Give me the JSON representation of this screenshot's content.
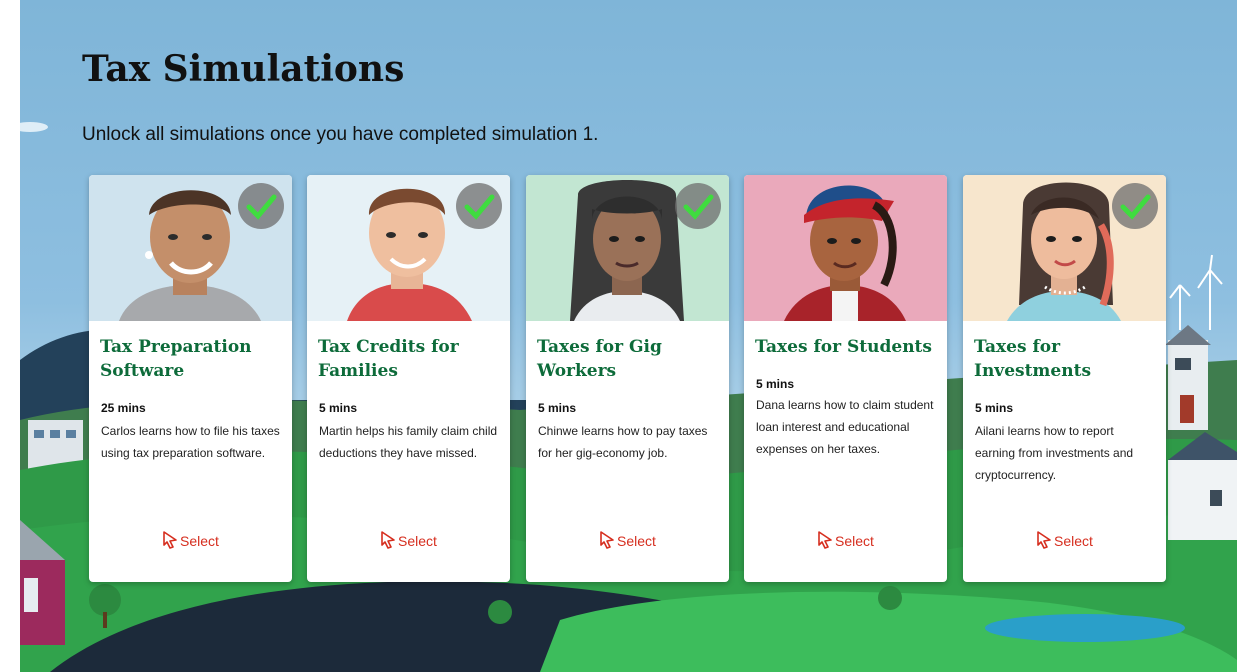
{
  "page": {
    "title": "Tax Simulations",
    "subtitle": "Unlock all simulations once you have completed simulation 1."
  },
  "colors": {
    "title_green": "#0d6b3a",
    "select_red": "#d62e1f",
    "check_green": "#3fdc3f"
  },
  "icons": {
    "completed": "checkmark-icon",
    "select": "cursor-pointer-icon"
  },
  "cards": [
    {
      "title": "Tax Preparation Software",
      "duration": "25 mins",
      "description": "Carlos learns how to file his taxes using tax preparation software.",
      "select_label": "Select",
      "completed": true,
      "portrait_bg": "#cfe3ee"
    },
    {
      "title": "Tax Credits for Families",
      "duration": "5 mins",
      "description": "Martin helps his family claim child deductions they have missed.",
      "select_label": "Select",
      "completed": true,
      "portrait_bg": "#e6f1f6"
    },
    {
      "title": "Taxes for Gig Workers",
      "duration": "5 mins",
      "description": "Chinwe learns how to pay taxes for her gig-economy job.",
      "select_label": "Select",
      "completed": true,
      "portrait_bg": "#c2e6d2"
    },
    {
      "title": "Taxes for Students",
      "duration": "5 mins",
      "description": "Dana learns how to claim student loan interest and educational expenses on her taxes.",
      "select_label": "Select",
      "completed": false,
      "portrait_bg": "#eaa9bb"
    },
    {
      "title": "Taxes for Investments",
      "duration": "5 mins",
      "description": "Ailani learns how to report earning from investments and cryptocurrency.",
      "select_label": "Select",
      "completed": true,
      "portrait_bg": "#f7e6cd"
    }
  ]
}
